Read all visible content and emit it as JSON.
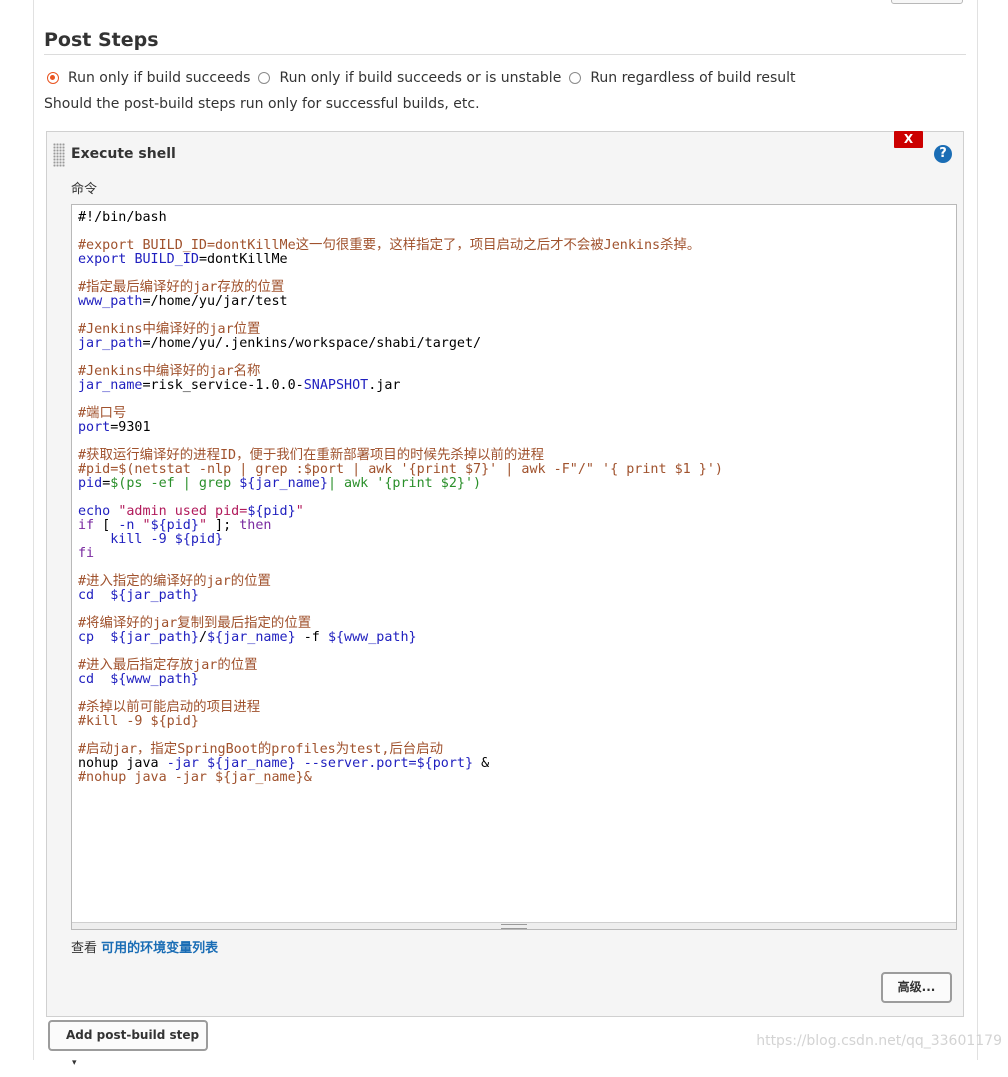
{
  "section": {
    "title": "Post Steps",
    "options": [
      {
        "label": "Run only if build succeeds",
        "checked": true
      },
      {
        "label": "Run only if build succeeds or is unstable",
        "checked": false
      },
      {
        "label": "Run regardless of build result",
        "checked": false
      }
    ],
    "help_text": "Should the post-build steps run only for successful builds, etc."
  },
  "step": {
    "title": "Execute shell",
    "delete_label": "X",
    "help_label": "?",
    "field_label": "命令"
  },
  "code_lines": [
    [
      {
        "t": "#!/bin/bash",
        "c": "plain"
      }
    ],
    [],
    [
      {
        "t": "#export BUILD_ID=dontKillMe这一句很重要，这样指定了，项目启动之后才不会被Jenkins杀掉。",
        "c": "comment"
      }
    ],
    [
      {
        "t": "export",
        "c": "builtin"
      },
      {
        "t": " ",
        "c": "plain"
      },
      {
        "t": "BUILD_ID",
        "c": "variable"
      },
      {
        "t": "=dontKillMe",
        "c": "plain"
      }
    ],
    [],
    [
      {
        "t": "#指定最后编译好的jar存放的位置",
        "c": "comment"
      }
    ],
    [
      {
        "t": "www_path",
        "c": "variable"
      },
      {
        "t": "=/home/yu/jar/test",
        "c": "plain"
      }
    ],
    [],
    [
      {
        "t": "#Jenkins中编译好的jar位置",
        "c": "comment"
      }
    ],
    [
      {
        "t": "jar_path",
        "c": "variable"
      },
      {
        "t": "=/home/yu/.jenkins/workspace/shabi/target/",
        "c": "plain"
      }
    ],
    [],
    [
      {
        "t": "#Jenkins中编译好的jar名称",
        "c": "comment"
      }
    ],
    [
      {
        "t": "jar_name",
        "c": "variable"
      },
      {
        "t": "=risk_service-1.0.0-",
        "c": "plain"
      },
      {
        "t": "SNAPSHOT",
        "c": "variable"
      },
      {
        "t": ".jar",
        "c": "plain"
      }
    ],
    [],
    [
      {
        "t": "#端口号",
        "c": "comment"
      }
    ],
    [
      {
        "t": "port",
        "c": "variable"
      },
      {
        "t": "=9301",
        "c": "plain"
      }
    ],
    [],
    [
      {
        "t": "#获取运行编译好的进程ID，便于我们在重新部署项目的时候先杀掉以前的进程",
        "c": "comment"
      }
    ],
    [
      {
        "t": "#pid=$(netstat -nlp | grep :$port | awk '{print $7}' | awk -F\"/\" '{ print $1 }')",
        "c": "comment"
      }
    ],
    [
      {
        "t": "pid",
        "c": "variable"
      },
      {
        "t": "=",
        "c": "plain"
      },
      {
        "t": "$(ps -ef | grep ",
        "c": "gstring"
      },
      {
        "t": "${jar_name}",
        "c": "variable"
      },
      {
        "t": "| awk '{print $2}')",
        "c": "gstring"
      }
    ],
    [],
    [
      {
        "t": "echo",
        "c": "builtin"
      },
      {
        "t": " ",
        "c": "plain"
      },
      {
        "t": "\"admin used pid=",
        "c": "string"
      },
      {
        "t": "${pid}",
        "c": "variable"
      },
      {
        "t": "\"",
        "c": "string"
      }
    ],
    [
      {
        "t": "if",
        "c": "keyword"
      },
      {
        "t": " [ ",
        "c": "plain"
      },
      {
        "t": "-n",
        "c": "builtin"
      },
      {
        "t": " ",
        "c": "plain"
      },
      {
        "t": "\"",
        "c": "string"
      },
      {
        "t": "${pid}",
        "c": "variable"
      },
      {
        "t": "\"",
        "c": "string"
      },
      {
        "t": " ]; ",
        "c": "plain"
      },
      {
        "t": "then",
        "c": "keyword"
      }
    ],
    [
      {
        "t": "    ",
        "c": "plain"
      },
      {
        "t": "kill -9 ${pid}",
        "c": "builtin"
      }
    ],
    [
      {
        "t": "fi",
        "c": "keyword"
      }
    ],
    [],
    [
      {
        "t": "#进入指定的编译好的jar的位置",
        "c": "comment"
      }
    ],
    [
      {
        "t": "cd",
        "c": "builtin"
      },
      {
        "t": "  ",
        "c": "plain"
      },
      {
        "t": "${jar_path}",
        "c": "variable"
      }
    ],
    [],
    [
      {
        "t": "#将编译好的jar复制到最后指定的位置",
        "c": "comment"
      }
    ],
    [
      {
        "t": "cp",
        "c": "builtin"
      },
      {
        "t": "  ",
        "c": "plain"
      },
      {
        "t": "${jar_path}",
        "c": "variable"
      },
      {
        "t": "/",
        "c": "plain"
      },
      {
        "t": "${jar_name}",
        "c": "variable"
      },
      {
        "t": " -f ",
        "c": "plain"
      },
      {
        "t": "${www_path}",
        "c": "variable"
      }
    ],
    [],
    [
      {
        "t": "#进入最后指定存放jar的位置",
        "c": "comment"
      }
    ],
    [
      {
        "t": "cd",
        "c": "builtin"
      },
      {
        "t": "  ",
        "c": "plain"
      },
      {
        "t": "${www_path}",
        "c": "variable"
      }
    ],
    [],
    [
      {
        "t": "#杀掉以前可能启动的项目进程",
        "c": "comment"
      }
    ],
    [
      {
        "t": "#kill -9 ${pid}",
        "c": "comment"
      }
    ],
    [],
    [
      {
        "t": "#启动jar，指定SpringBoot的profiles为test,后台启动",
        "c": "comment"
      }
    ],
    [
      {
        "t": "nohup java ",
        "c": "plain"
      },
      {
        "t": "-jar",
        "c": "builtin"
      },
      {
        "t": " ",
        "c": "plain"
      },
      {
        "t": "${jar_name}",
        "c": "variable"
      },
      {
        "t": " ",
        "c": "plain"
      },
      {
        "t": "--server.port=",
        "c": "builtin"
      },
      {
        "t": "${port}",
        "c": "variable"
      },
      {
        "t": " &",
        "c": "plain"
      }
    ],
    [
      {
        "t": "#nohup java -jar ${jar_name}&",
        "c": "comment"
      }
    ]
  ],
  "env_hint": {
    "prefix": "查看 ",
    "link": "可用的环境变量列表"
  },
  "advanced_label": "高级...",
  "add_step_label": "Add post-build step",
  "add_step_caret": "▾",
  "watermark": "https://blog.csdn.net/qq_33601179"
}
